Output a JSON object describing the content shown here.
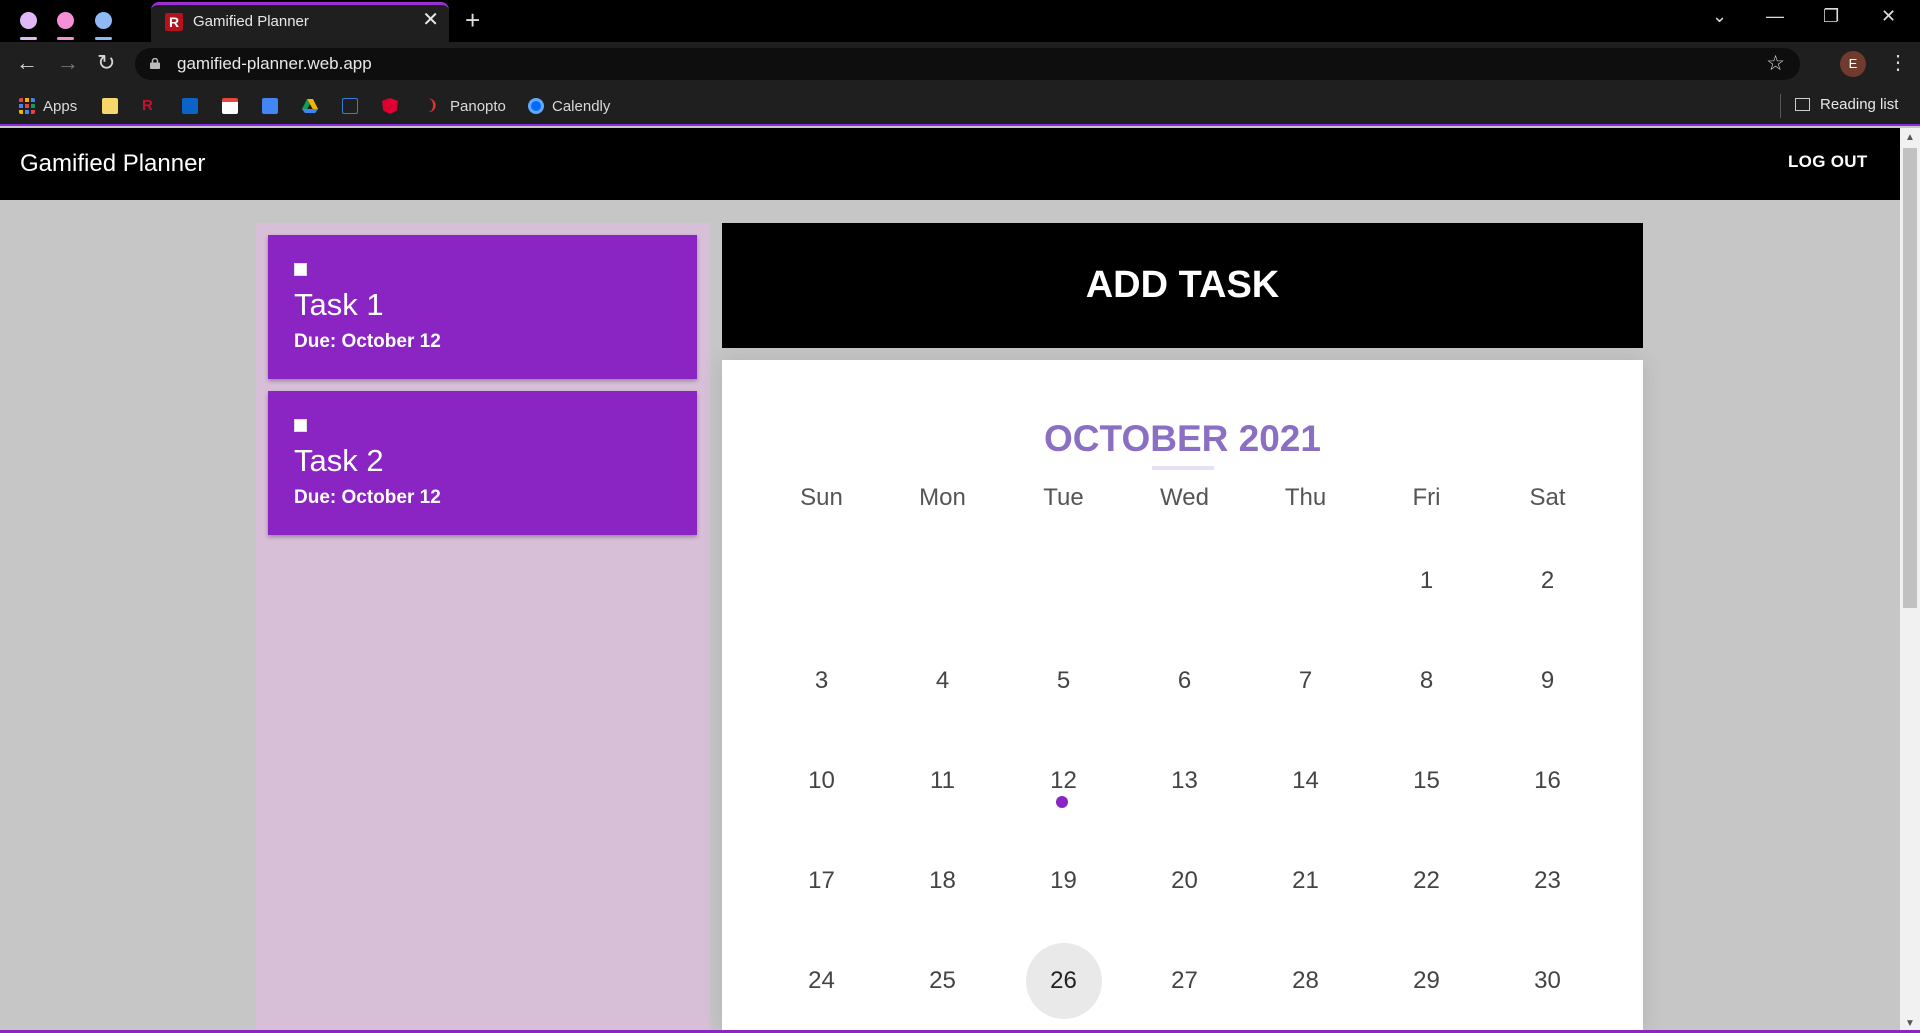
{
  "browser": {
    "tab_title": "Gamified Planner",
    "favicon_letter": "R",
    "close_glyph": "✕",
    "new_tab_glyph": "+",
    "url": "gamified-planner.web.app",
    "profile_initial": "E",
    "window_controls": {
      "dropdown": "⌄",
      "minimize": "—",
      "restore": "❐",
      "close": "✕"
    },
    "bookmarks": [
      {
        "label": "Apps",
        "icon": "apps-grid-icon"
      },
      {
        "label": "",
        "icon": "folder-icon"
      },
      {
        "label": "",
        "icon": "r-icon"
      },
      {
        "label": "",
        "icon": "outlook-icon"
      },
      {
        "label": "",
        "icon": "gmail-icon"
      },
      {
        "label": "",
        "icon": "calendar-icon"
      },
      {
        "label": "",
        "icon": "drive-icon"
      },
      {
        "label": "",
        "icon": "c-icon"
      },
      {
        "label": "",
        "icon": "angular-icon"
      },
      {
        "label": "Panopto",
        "icon": "panopto-icon"
      },
      {
        "label": "Calendly",
        "icon": "calendly-icon"
      }
    ],
    "reading_list": "Reading list"
  },
  "header": {
    "title": "Gamified Planner",
    "logout_label": "LOG OUT"
  },
  "tasks": [
    {
      "name": "Task 1",
      "due": "Due: October 12"
    },
    {
      "name": "Task 2",
      "due": "Due: October 12"
    }
  ],
  "add_task_label": "ADD TASK",
  "calendar": {
    "title": "OCTOBER 2021",
    "weekdays": [
      "Sun",
      "Mon",
      "Tue",
      "Wed",
      "Thu",
      "Fri",
      "Sat"
    ],
    "days": [
      "1",
      "2",
      "3",
      "4",
      "5",
      "6",
      "7",
      "8",
      "9",
      "10",
      "11",
      "12",
      "13",
      "14",
      "15",
      "16",
      "17",
      "18",
      "19",
      "20",
      "21",
      "22",
      "23",
      "24",
      "25",
      "26",
      "27",
      "28",
      "29",
      "30"
    ],
    "first_weekday_index": 5,
    "today": "26",
    "event_day": "12"
  },
  "colors": {
    "accent": "#8a25c4",
    "panel": "#d8bfd8",
    "calendar_title": "#8a6fc2"
  }
}
